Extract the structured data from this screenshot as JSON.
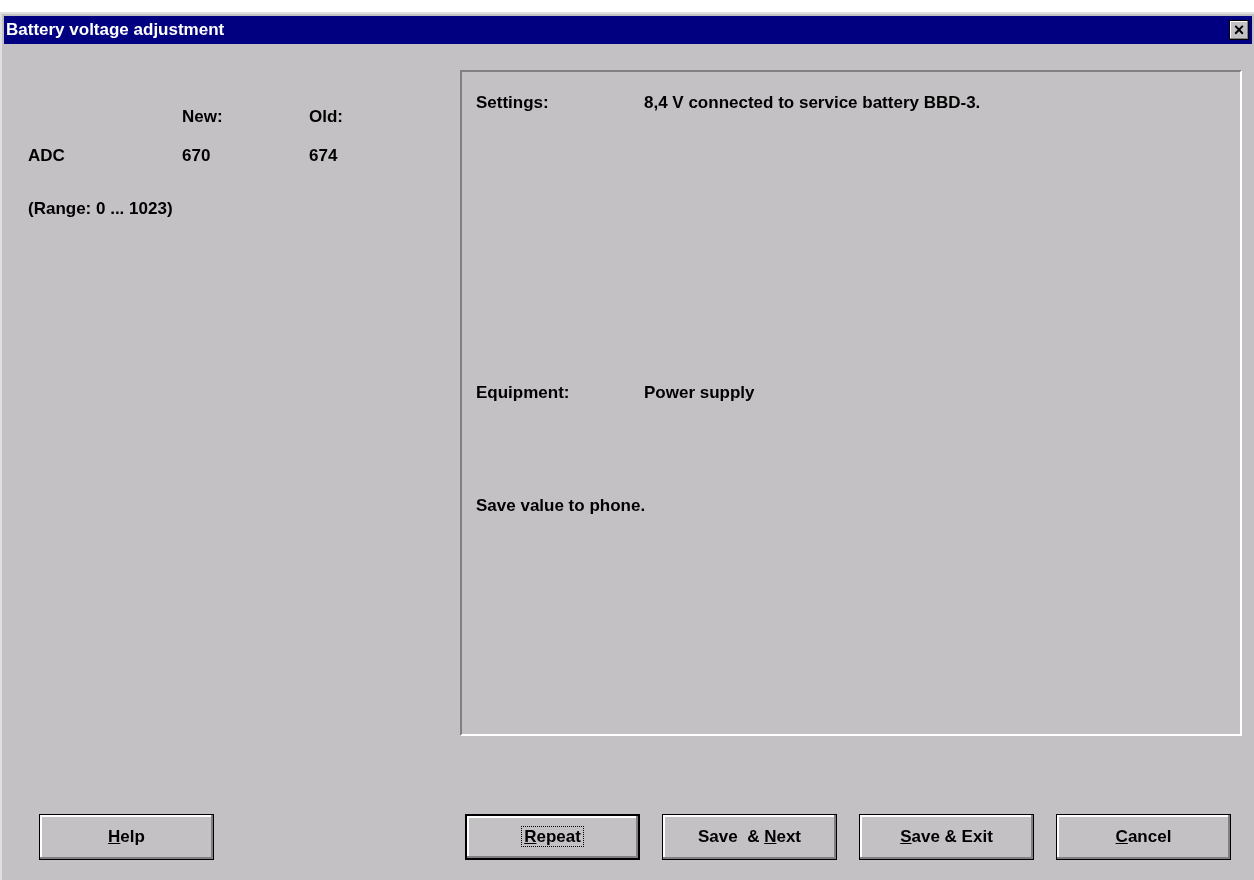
{
  "window": {
    "title": "Battery voltage adjustment",
    "close": "×"
  },
  "values": {
    "headers": [
      "New:",
      "Old:"
    ],
    "rows": [
      {
        "label": "ADC",
        "new": "670",
        "old": "674"
      }
    ],
    "range": "(Range: 0 ... 1023)"
  },
  "info": {
    "settings": {
      "label": "Settings:",
      "value": "8,4 V connected to service battery BBD-3."
    },
    "equipment": {
      "label": "Equipment:",
      "value": "Power supply"
    },
    "message": "Save value to phone."
  },
  "buttons": [
    {
      "key": "H",
      "after": "elp",
      "default": false
    },
    {
      "key": "R",
      "after": "epeat",
      "default": true
    },
    {
      "before": "Save  & ",
      "key": "N",
      "after": "ext",
      "default": false
    },
    {
      "key": "S",
      "after": "ave & Exit",
      "default": false
    },
    {
      "key": "C",
      "after": "ancel",
      "default": false
    }
  ]
}
